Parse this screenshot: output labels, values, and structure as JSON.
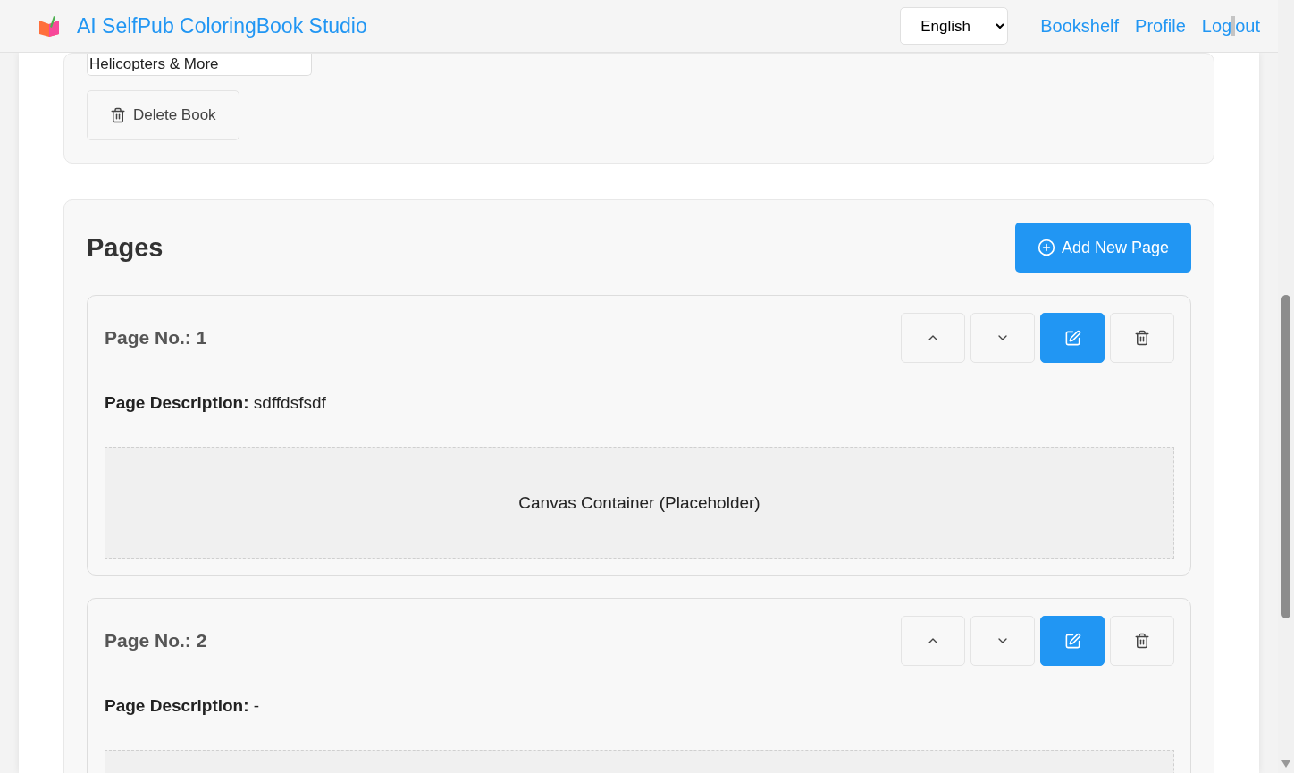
{
  "header": {
    "title": "AI SelfPub ColoringBook Studio",
    "language": "English",
    "links": [
      "Bookshelf",
      "Profile",
      "Log",
      "out"
    ]
  },
  "book": {
    "subtitle_value": "Helicopters & More",
    "delete_label": "Delete Book"
  },
  "pages_section": {
    "title": "Pages",
    "add_label": "Add New Page",
    "pages": [
      {
        "number_label": "Page No.:",
        "number": "1",
        "description_label": "Page Description:",
        "description": "sdffdsfsdf",
        "canvas_label": "Canvas Container (Placeholder)"
      },
      {
        "number_label": "Page No.:",
        "number": "2",
        "description_label": "Page Description:",
        "description": "-"
      }
    ]
  }
}
